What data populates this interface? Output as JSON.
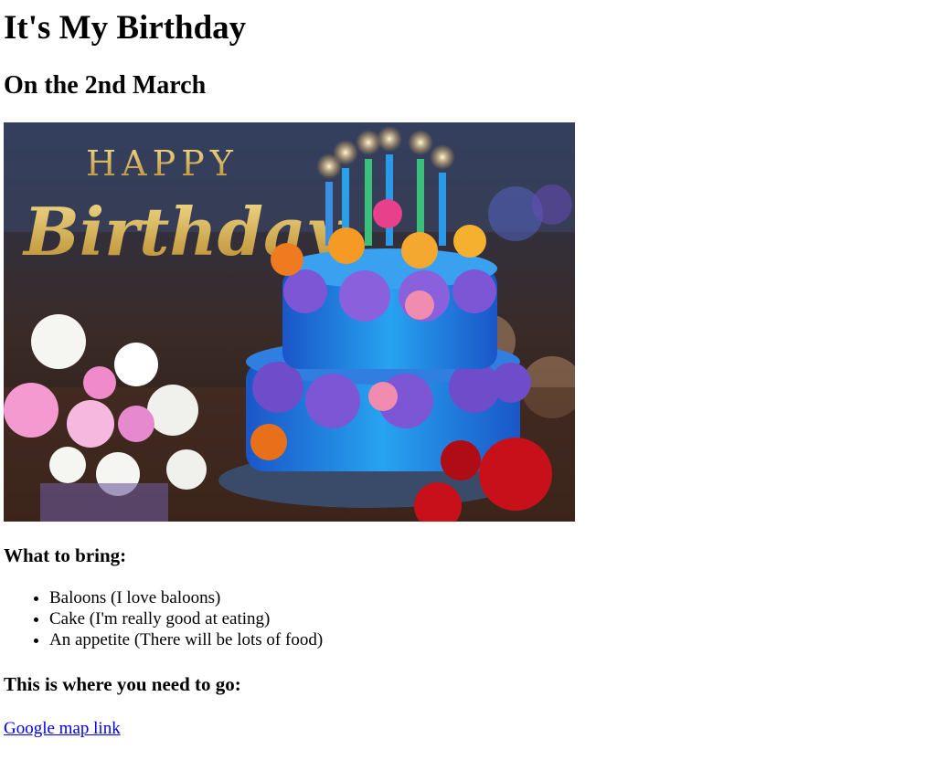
{
  "page": {
    "title": "It's My Birthday",
    "date_heading": "On the 2nd March"
  },
  "hero_image": {
    "alt": "Happy Birthday cake",
    "caption_line1": "HAPPY",
    "caption_line2": "Birthday"
  },
  "bring": {
    "heading": "What to bring:",
    "items": [
      "Baloons (I love baloons)",
      "Cake (I'm really good at eating)",
      "An appetite (There will be lots of food)"
    ]
  },
  "directions": {
    "heading": "This is where you need to go:",
    "link_text": "Google map link"
  },
  "colors": {
    "link": "#0000ee",
    "text": "#000000",
    "background": "#ffffff"
  }
}
